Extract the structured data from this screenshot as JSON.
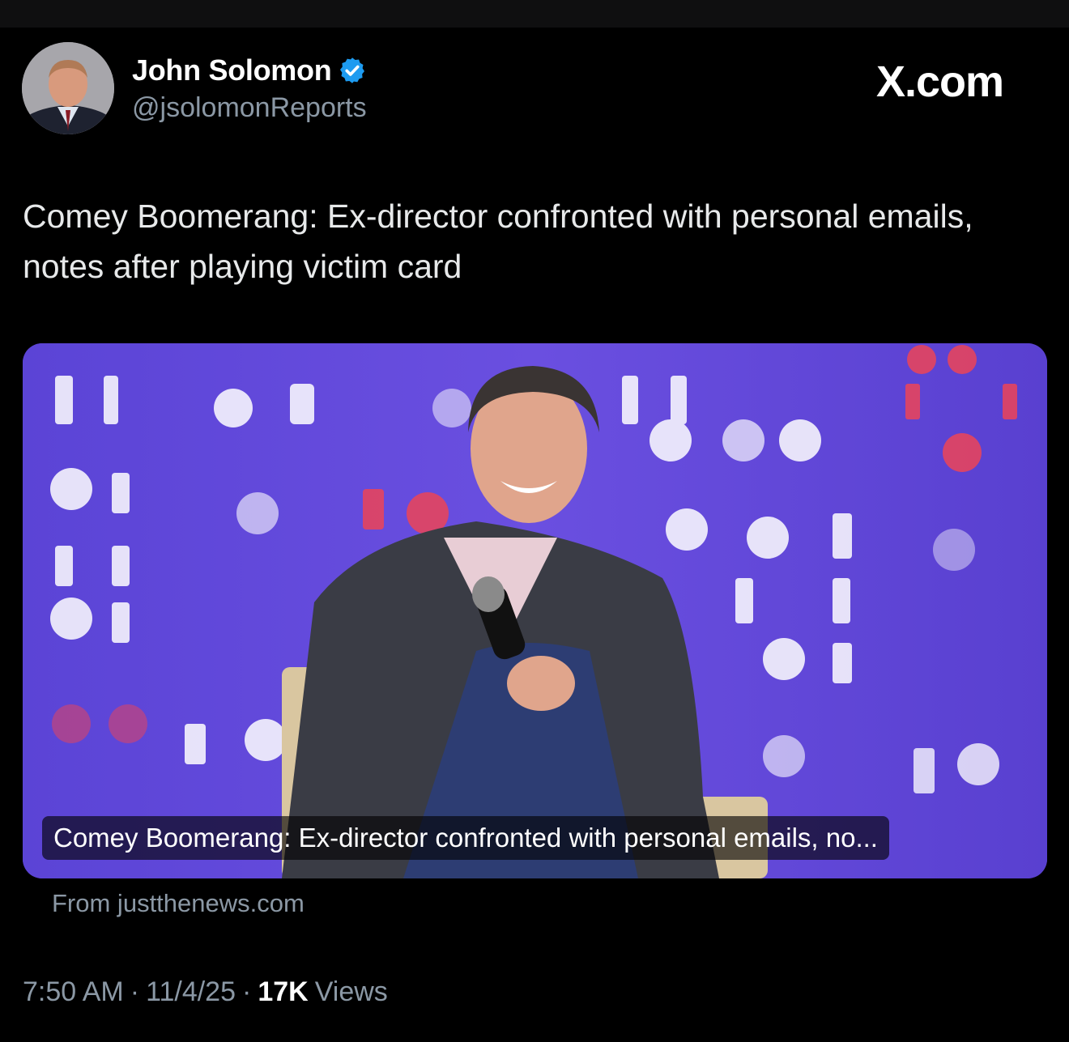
{
  "author": {
    "name": "John Solomon",
    "handle": "@jsolomonReports",
    "verified": true,
    "avatar_icon": "avatar-photo-icon"
  },
  "brand": {
    "label": "X.com"
  },
  "tweet": {
    "text": "Comey Boomerang: Ex-director confronted with personal emails, notes after playing victim card"
  },
  "card": {
    "caption": "Comey Boomerang: Ex-director confronted with personal emails, no...",
    "source": "From justthenews.com",
    "image_icon": "speaker-on-stage-photo"
  },
  "meta": {
    "time": "7:50 AM",
    "sep1": "·",
    "date": "11/4/25",
    "sep2": "·",
    "views_count": "17K",
    "views_label": "Views"
  },
  "colors": {
    "background": "#000000",
    "text": "#e7e9ea",
    "muted": "#8b98a5",
    "verified_blue": "#1d9bf0",
    "card_purple": "#5a3fd0"
  }
}
